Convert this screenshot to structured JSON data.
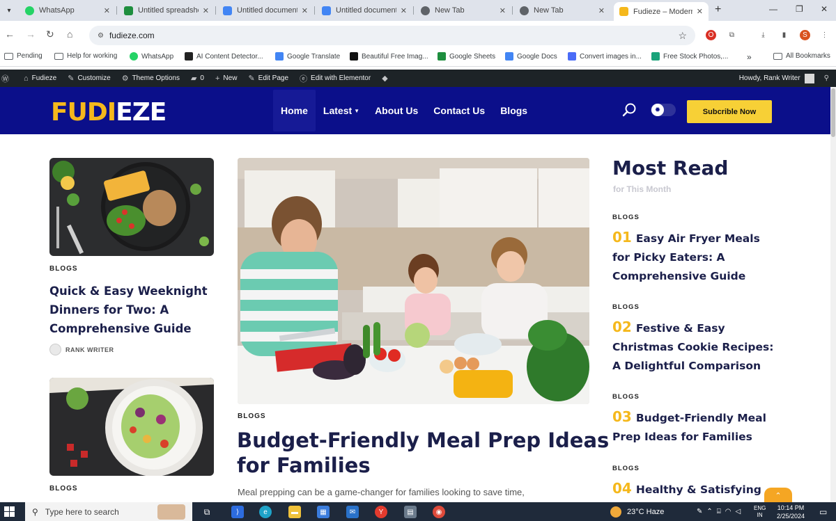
{
  "browser": {
    "tabs": [
      {
        "title": "WhatsApp",
        "icon": "whatsapp-icon",
        "color": "#25d366"
      },
      {
        "title": "Untitled spreadsheet",
        "icon": "sheets-icon",
        "color": "#1e8e3e"
      },
      {
        "title": "Untitled document",
        "icon": "docs-icon",
        "color": "#4285f4"
      },
      {
        "title": "Untitled document",
        "icon": "docs-icon",
        "color": "#4285f4"
      },
      {
        "title": "New Tab",
        "icon": "globe-icon",
        "color": "#5f6368"
      },
      {
        "title": "New Tab",
        "icon": "globe-icon",
        "color": "#5f6368"
      },
      {
        "title": "Fudieze – Modern",
        "icon": "fudieze-favicon",
        "color": "#f5b81c",
        "active": true
      }
    ],
    "url": "fudieze.com",
    "profile_initial": "S",
    "bookmarks": [
      {
        "label": "Pending",
        "type": "folder"
      },
      {
        "label": "Help for working",
        "type": "folder"
      },
      {
        "label": "WhatsApp",
        "color": "#25d366"
      },
      {
        "label": "AI Content Detector...",
        "color": "#222222"
      },
      {
        "label": "Google Translate",
        "color": "#4285f4"
      },
      {
        "label": "Beautiful Free Imag...",
        "color": "#111111"
      },
      {
        "label": "Google Sheets",
        "color": "#1e8e3e"
      },
      {
        "label": "Google Docs",
        "color": "#4285f4"
      },
      {
        "label": "Convert images in...",
        "color": "#4a6cf7"
      },
      {
        "label": "Free Stock Photos,...",
        "color": "#1aa37a"
      }
    ],
    "all_bookmarks": "All Bookmarks",
    "more_chevron": "»"
  },
  "adminbar": {
    "site": "Fudieze",
    "customize": "Customize",
    "theme_options": "Theme Options",
    "comments": "0",
    "new": "New",
    "edit_page": "Edit Page",
    "edit_elementor": "Edit with Elementor",
    "howdy": "Howdy, Rank Writer"
  },
  "header": {
    "logo_part1": "FUDI",
    "logo_part2": "EZE",
    "nav": [
      {
        "label": "Home",
        "current": true
      },
      {
        "label": "Latest",
        "dropdown": true
      },
      {
        "label": "About Us"
      },
      {
        "label": "Contact Us"
      },
      {
        "label": "Blogs"
      }
    ],
    "subscribe": "Subcrible Now"
  },
  "left_posts": [
    {
      "category": "BLOGS",
      "title_lines": [
        "Quick & Easy Weeknight",
        "Dinners for Two: A",
        "Comprehensive Guide"
      ],
      "author": "RANK WRITER"
    },
    {
      "category": "BLOGS"
    }
  ],
  "feature": {
    "category": "BLOGS",
    "title_lines": [
      "Budget-Friendly Meal Prep Ideas",
      "for Families"
    ],
    "excerpt": "Meal prepping can be a game-changer for families looking to save time,"
  },
  "most_read": {
    "title": "Most Read",
    "subtitle": "for This Month",
    "items": [
      {
        "category": "BLOGS",
        "number": "01",
        "title_lines": [
          "Easy Air Fryer Meals",
          "for Picky Eaters: A",
          "Comprehensive Guide"
        ]
      },
      {
        "category": "BLOGS",
        "number": "02",
        "title_lines": [
          "Festive & Easy",
          "Christmas Cookie Recipes:",
          "A Delightful Comparison"
        ]
      },
      {
        "category": "BLOGS",
        "number": "03",
        "title_lines": [
          "Budget-Friendly Meal",
          "Prep Ideas for Families"
        ]
      },
      {
        "category": "BLOGS",
        "number": "04",
        "title_lines": [
          "Healthy & Satisfying"
        ]
      }
    ]
  },
  "taskbar": {
    "search_placeholder": "Type here to search",
    "weather": "23°C  Haze",
    "lang_top": "ENG",
    "lang_bottom": "IN",
    "time": "10:14 PM",
    "date": "2/25/2024"
  }
}
